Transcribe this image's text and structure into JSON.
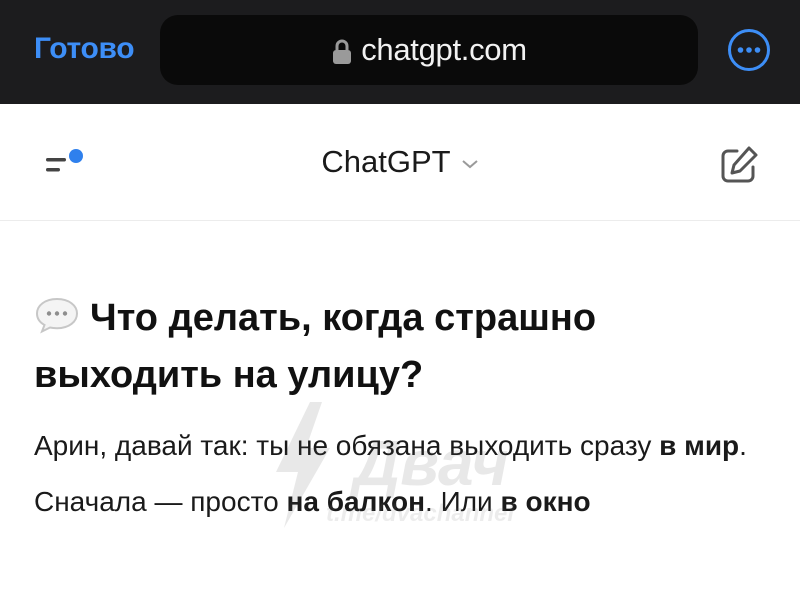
{
  "browser": {
    "done_label": "Готово",
    "url": "chatgpt.com",
    "more_icon": "ellipsis-circle-icon",
    "lock_icon": "lock-icon",
    "accent": "#3d8ef7"
  },
  "header": {
    "menu_icon": "sidebar-menu-icon",
    "model_label": "ChatGPT",
    "edit_icon": "new-chat-icon",
    "notification_dot_color": "#2f80ed"
  },
  "message": {
    "heading_icon": "speech-bubble-icon",
    "heading": "Что делать, когда страшно выходить на улицу?",
    "p1_a": "Арин, давай так: ты не обязана выходить сразу ",
    "p1_b": "в мир",
    "p1_c": ".",
    "p2_a": "Сначала — просто ",
    "p2_b": "на балкон",
    "p2_c": ". Или ",
    "p2_d": "в окно"
  },
  "watermark": {
    "word": "Двач",
    "url": "t.me/dvachannel"
  }
}
